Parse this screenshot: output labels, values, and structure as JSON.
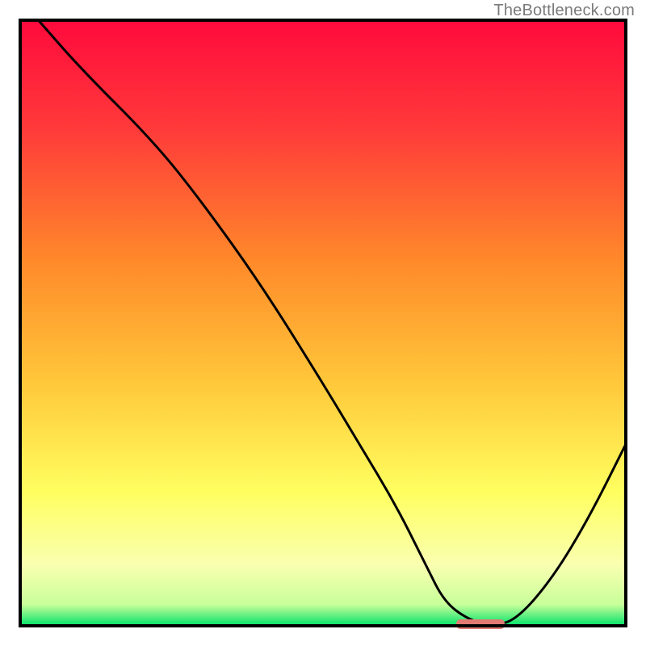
{
  "watermark": "TheBottleneck.com",
  "colors": {
    "frame": "#000000",
    "line": "#000000",
    "marker": "#e07a72",
    "gradient_stops": [
      {
        "offset": 0.0,
        "color": "#ff0a3c"
      },
      {
        "offset": 0.18,
        "color": "#ff3a3a"
      },
      {
        "offset": 0.4,
        "color": "#ff8a2a"
      },
      {
        "offset": 0.6,
        "color": "#ffc83a"
      },
      {
        "offset": 0.78,
        "color": "#ffff60"
      },
      {
        "offset": 0.9,
        "color": "#f9ffb0"
      },
      {
        "offset": 0.965,
        "color": "#c8ff9a"
      },
      {
        "offset": 1.0,
        "color": "#00e26a"
      }
    ]
  },
  "chart_data": {
    "type": "line",
    "title": "",
    "xlabel": "",
    "ylabel": "",
    "xlim": [
      0,
      100
    ],
    "ylim": [
      0,
      100
    ],
    "series": [
      {
        "name": "curve",
        "x": [
          3,
          10,
          22,
          30,
          40,
          50,
          56,
          62,
          67,
          70,
          74,
          78,
          82,
          88,
          94,
          100
        ],
        "values": [
          100,
          92,
          80,
          70,
          56,
          40,
          30,
          20,
          10,
          4,
          1,
          0,
          1,
          8,
          18,
          30
        ]
      }
    ],
    "marker": {
      "x_start": 72,
      "x_end": 80,
      "y": 0
    }
  }
}
